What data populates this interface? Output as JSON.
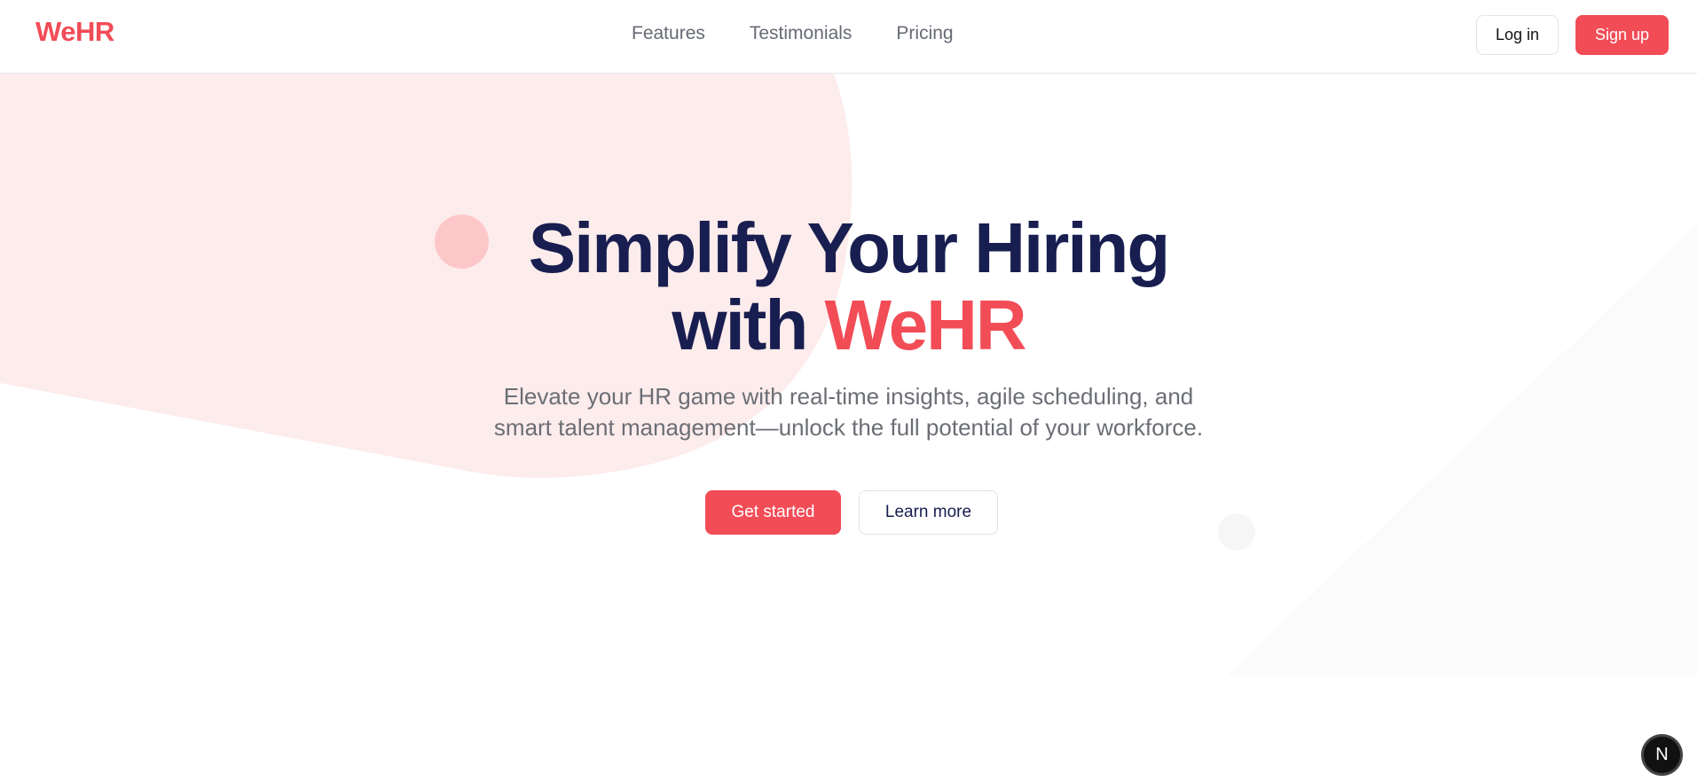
{
  "header": {
    "logo": "WeHR",
    "nav": [
      "Features",
      "Testimonials",
      "Pricing"
    ],
    "login_label": "Log in",
    "signup_label": "Sign up"
  },
  "hero": {
    "title_line1": "Simplify Your Hiring",
    "title_line2_prefix": "with ",
    "title_line2_accent": "WeHR",
    "subtitle_line1": "Elevate your HR game with real-time insights, agile scheduling, and",
    "subtitle_line2": "smart talent management—unlock the full potential of your workforce.",
    "primary_cta": "Get started",
    "secondary_cta": "Learn more"
  },
  "badge": {
    "label": "N"
  },
  "colors": {
    "accent": "#f24c57",
    "heading": "#181e4f",
    "blob": "#fdecec"
  }
}
